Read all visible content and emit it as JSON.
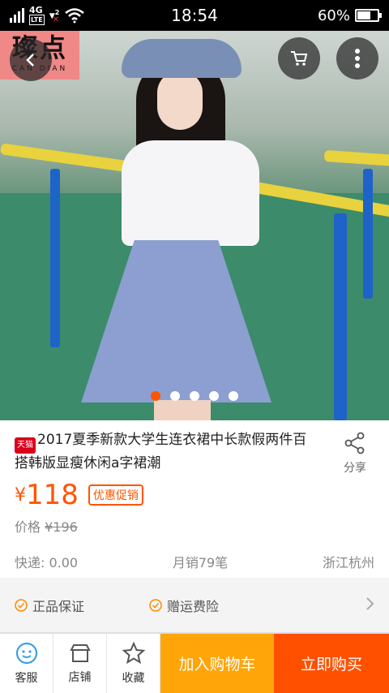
{
  "status_bar": {
    "network": "4G",
    "network_sub": "LTE",
    "sim2": "2",
    "time": "18:54",
    "battery": "60%",
    "battery_level": 0.6
  },
  "hero": {
    "logo_cn": "璨点",
    "logo_en": "CAN DIAN",
    "slides_total": 5,
    "slide_active": 1
  },
  "product": {
    "badge": "天猫",
    "title": "2017夏季新款大学生连衣裙中长款假两件百搭韩版显瘦休闲a字裙潮",
    "share_label": "分享",
    "price_symbol": "¥",
    "price": "118",
    "promo_label": "优惠促销",
    "original_label": "价格",
    "original_price": "¥196",
    "shipping": "快递: 0.00",
    "monthly_sales": "月销79笔",
    "location": "浙江杭州"
  },
  "services": [
    {
      "label": "正品保证"
    },
    {
      "label": "赠运费险"
    }
  ],
  "bottom_bar": {
    "customer_service": "客服",
    "store": "店铺",
    "favorite": "收藏",
    "add_to_cart": "加入购物车",
    "buy_now": "立即购买"
  },
  "colors": {
    "accent": "#ff5500",
    "cart": "#ffa50a",
    "buy": "#ff5000",
    "service_blue": "#3aa0e8"
  }
}
